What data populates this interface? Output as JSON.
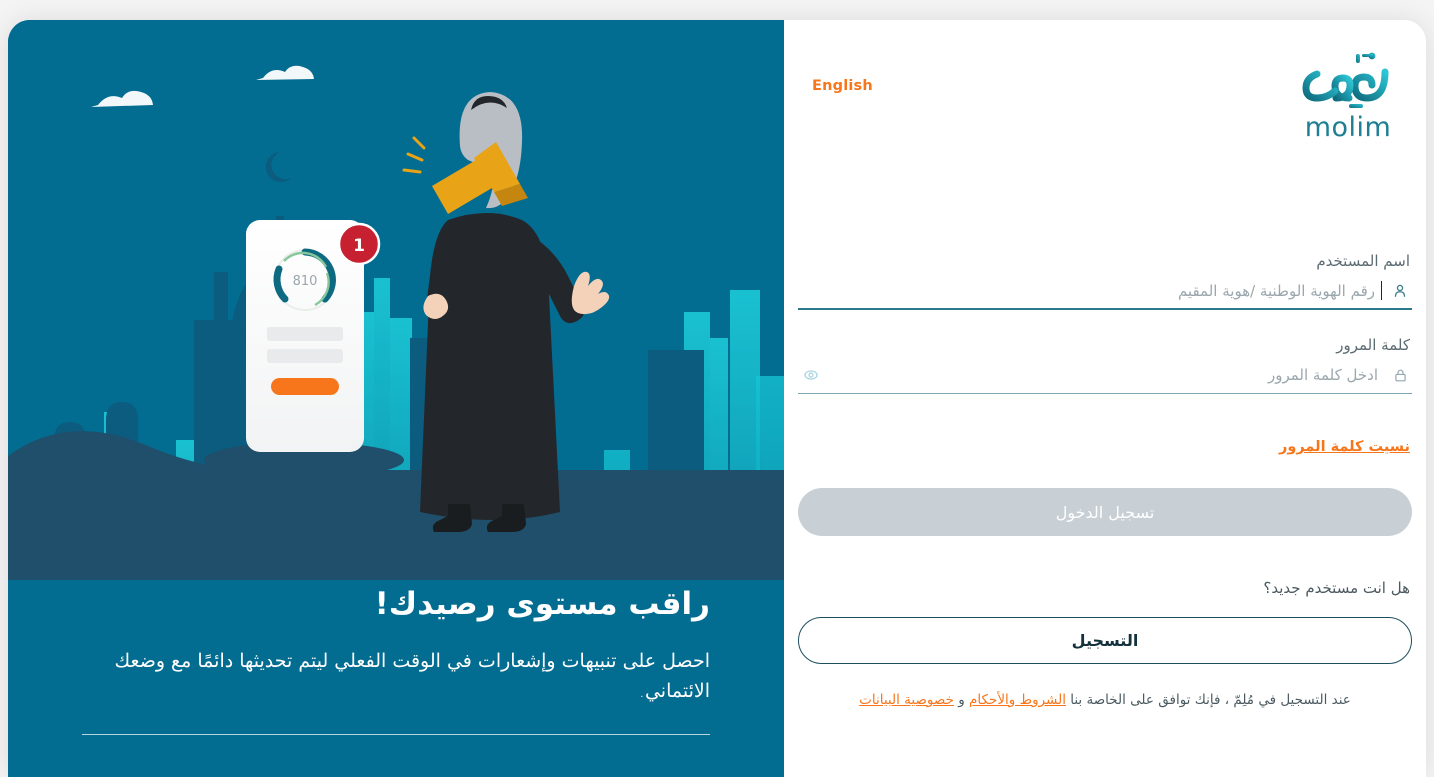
{
  "brand": {
    "name_ar": "مُلِمّ",
    "name_latin": "molim",
    "logo_gradient_start": "#0F6B7E",
    "logo_gradient_end": "#2CC6D6"
  },
  "language_switch": {
    "label": "English"
  },
  "form": {
    "username": {
      "label": "اسم المستخدم",
      "placeholder": "رقم الهوية الوطنية /هوية المقيم",
      "value": "",
      "icon": "user-icon"
    },
    "password": {
      "label": "كلمة المرور",
      "placeholder": "ادخل كلمة المرور",
      "value": "",
      "icon": "lock-icon",
      "toggle_icon": "eye-icon"
    },
    "forgot_password_label": "نسيت كلمة المرور",
    "login_button_label": "تسجيل الدخول",
    "new_user_prompt": "هل انت مستخدم جديد؟",
    "register_button_label": "التسجيل",
    "terms": {
      "prefix": "عند التسجيل في مُلِمّ ، فإنك توافق على الخاصة بنا ",
      "terms_link": "الشروط والأحكام",
      "conjunction": " و ",
      "privacy_link": "خصوصية البيانات"
    }
  },
  "promo": {
    "title": "راقب مستوى رصيدك!",
    "body": "احصل على تنبيهات وإشعارات في الوقت الفعلي ليتم تحديثها دائمًا مع وضعك الائتماني."
  },
  "illustration": {
    "name": "riyadh-skyline-credit-score-illustration",
    "phone_score": "810",
    "notification_badge": "1",
    "phone_cta_color": "#F7761B",
    "badge_color": "#C62031",
    "megaphone_color": "#E8A317",
    "panel_background": "#036C91",
    "band_color": "#1F4F6B",
    "building_light": "#13C0D4",
    "building_mid": "#0E8FA8",
    "building_dark": "#0B5C7E"
  },
  "colors": {
    "accent_orange": "#F7761B",
    "teal_underline": "#2B7A8C",
    "disabled_button": "#C8CFD5",
    "register_outline": "#1D4F5E"
  }
}
